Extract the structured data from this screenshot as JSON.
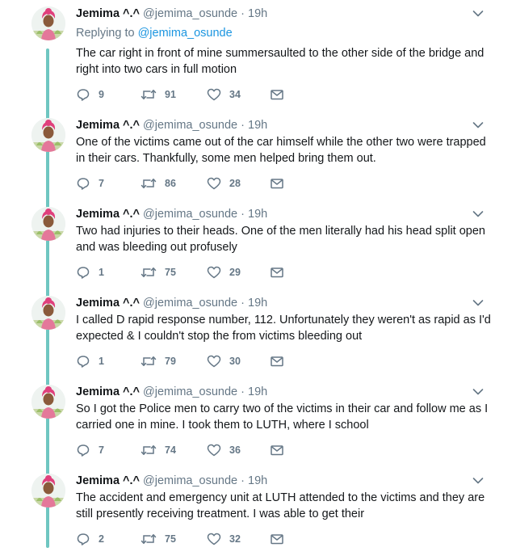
{
  "thread": {
    "replying_prefix": "Replying to ",
    "replying_handle": "@jemima_osunde",
    "tweets": [
      {
        "name": "Jemima ^.^",
        "handle": "@jemima_osunde",
        "sep": "·",
        "time": "19h",
        "text": "The car right in front of mine summersaulted to the other side of the bridge and right into two cars in full motion",
        "replies": "9",
        "retweets": "91",
        "likes": "34"
      },
      {
        "name": "Jemima ^.^",
        "handle": "@jemima_osunde",
        "sep": "·",
        "time": "19h",
        "text": "One of the victims came out of the car himself while the other two were trapped in their cars. Thankfully, some men helped bring them out.",
        "replies": "7",
        "retweets": "86",
        "likes": "28"
      },
      {
        "name": "Jemima ^.^",
        "handle": "@jemima_osunde",
        "sep": "·",
        "time": "19h",
        "text": "Two had injuries to their heads. One of the men literally had his head split open and was bleeding out profusely",
        "replies": "1",
        "retweets": "75",
        "likes": "29"
      },
      {
        "name": "Jemima ^.^",
        "handle": "@jemima_osunde",
        "sep": "·",
        "time": "19h",
        "text": "I called D rapid response number, 112. Unfortunately they weren't as rapid as I'd expected & I couldn't stop the from victims bleeding out",
        "replies": "1",
        "retweets": "79",
        "likes": "30"
      },
      {
        "name": "Jemima ^.^",
        "handle": "@jemima_osunde",
        "sep": "·",
        "time": "19h",
        "text": "So I got the Police men to carry two of the victims in their car and follow me as I carried one in mine. I took them to LUTH, where I school",
        "replies": "7",
        "retweets": "74",
        "likes": "36"
      },
      {
        "name": "Jemima ^.^",
        "handle": "@jemima_osunde",
        "sep": "·",
        "time": "19h",
        "text": "The accident and emergency unit at LUTH attended to the victims and they are still presently receiving treatment. I was able to get their",
        "replies": "2",
        "retweets": "75",
        "likes": "32"
      }
    ]
  },
  "icons": {
    "reply": "reply-icon",
    "retweet": "retweet-icon",
    "like": "heart-icon",
    "dm": "envelope-icon",
    "caret": "chevron-down-icon"
  },
  "colors": {
    "thread_line": "#6fc6c1",
    "link": "#1b95e0",
    "muted": "#657786",
    "text": "#14171a",
    "icon": "#657786"
  }
}
